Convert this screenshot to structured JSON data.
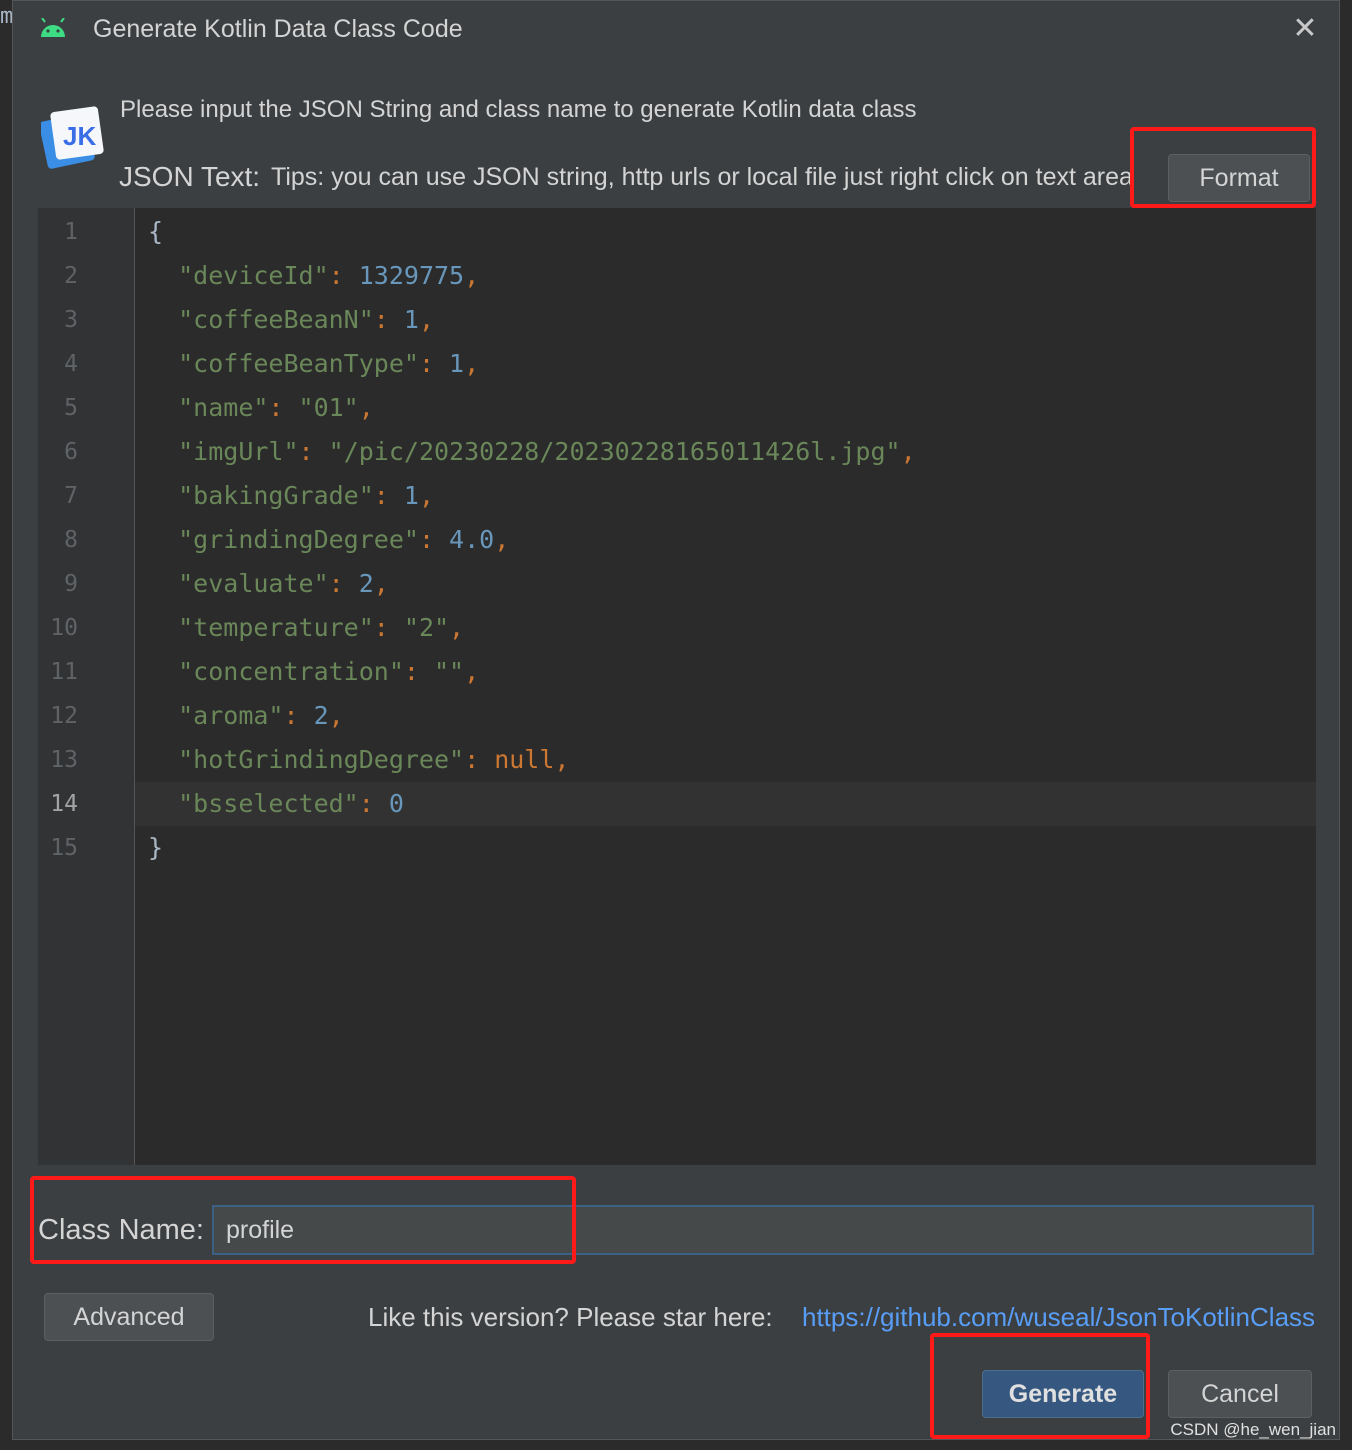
{
  "dialog": {
    "title": "Generate Kotlin Data Class Code",
    "close_glyph": "✕",
    "intro": "Please input the JSON String and class name to generate Kotlin data class",
    "json_label": "JSON Text:",
    "json_tips": "Tips: you can use JSON string, http urls or local file just right click on text area",
    "format_label": "Format",
    "class_name_label": "Class Name:",
    "class_name_value": "profile",
    "advanced_label": "Advanced",
    "star_text": "Like this version? Please star here:",
    "star_link": "https://github.com/wuseal/JsonToKotlinClass",
    "generate_label": "Generate",
    "cancel_label": "Cancel",
    "logo_text": "JK"
  },
  "editor": {
    "current_line": 14,
    "lines": [
      {
        "n": "1",
        "open": "{"
      },
      {
        "n": "2",
        "key": "\"deviceId\"",
        "value": "1329775",
        "type": "num",
        "comma": true
      },
      {
        "n": "3",
        "key": "\"coffeeBeanN\"",
        "value": "1",
        "type": "num",
        "comma": true
      },
      {
        "n": "4",
        "key": "\"coffeeBeanType\"",
        "value": "1",
        "type": "num",
        "comma": true
      },
      {
        "n": "5",
        "key": "\"name\"",
        "value": "\"01\"",
        "type": "str",
        "comma": true
      },
      {
        "n": "6",
        "key": "\"imgUrl\"",
        "value": "\"/pic/20230228/20230228165011426l.jpg\"",
        "type": "str",
        "comma": true
      },
      {
        "n": "7",
        "key": "\"bakingGrade\"",
        "value": "1",
        "type": "num",
        "comma": true
      },
      {
        "n": "8",
        "key": "\"grindingDegree\"",
        "value": "4.0",
        "type": "num",
        "comma": true
      },
      {
        "n": "9",
        "key": "\"evaluate\"",
        "value": "2",
        "type": "num",
        "comma": true
      },
      {
        "n": "10",
        "key": "\"temperature\"",
        "value": "\"2\"",
        "type": "str",
        "comma": true
      },
      {
        "n": "11",
        "key": "\"concentration\"",
        "value": "\"\"",
        "type": "str",
        "comma": true
      },
      {
        "n": "12",
        "key": "\"aroma\"",
        "value": "2",
        "type": "num",
        "comma": true
      },
      {
        "n": "13",
        "key": "\"hotGrindingDegree\"",
        "value": "null",
        "type": "nul",
        "comma": true
      },
      {
        "n": "14",
        "key": "\"bsselected\"",
        "value": "0",
        "type": "num",
        "comma": false
      },
      {
        "n": "15",
        "close": "}"
      }
    ]
  },
  "watermark": "CSDN @he_wen_jian",
  "colors": {
    "accent_red_box": "#ff1a1a",
    "generate_button": "#365880",
    "link": "#589df6",
    "json_key": "#6a8759",
    "json_number": "#6897bb",
    "json_punctuation": "#cc7832"
  }
}
